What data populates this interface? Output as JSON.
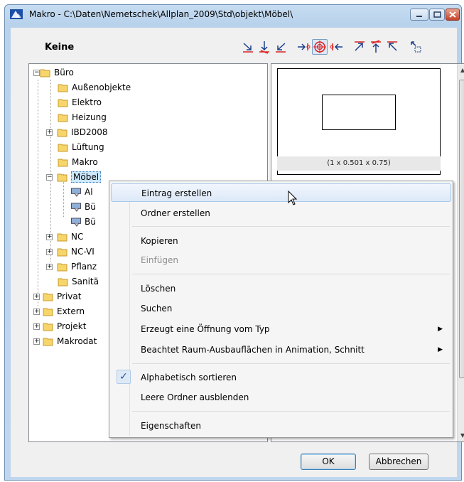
{
  "window": {
    "title": "Makro - C:\\Daten\\Nemetschek\\Allplan_2009\\Std\\objekt\\Möbel\\"
  },
  "header": {
    "label": "Keine"
  },
  "tree": {
    "root": "Büro",
    "children": [
      "Außenobjekte",
      "Elektro",
      "Heizung",
      "IBD2008",
      "Lüftung",
      "Makro",
      "Möbel"
    ],
    "moebel_items": [
      "Al",
      "Bü",
      "Bü"
    ],
    "after": [
      "NC",
      "NC-VI",
      "Pflanz",
      "Sanitä"
    ],
    "top_level": [
      "Privat",
      "Extern",
      "Projekt",
      "Makrodat"
    ]
  },
  "preview": {
    "caption": "(1 x 0.501 x 0.75)"
  },
  "context_menu": {
    "items": [
      {
        "label": "Eintrag erstellen"
      },
      {
        "label": "Ordner erstellen"
      },
      {
        "label": "Kopieren"
      },
      {
        "label": "Einfügen"
      },
      {
        "label": "Löschen"
      },
      {
        "label": "Suchen"
      },
      {
        "label": "Erzeugt eine Öffnung vom Typ"
      },
      {
        "label": "Beachtet Raum-Ausbauflächen in Animation, Schnitt"
      },
      {
        "label": "Alphabetisch sortieren"
      },
      {
        "label": "Leere Ordner ausblenden"
      },
      {
        "label": "Eigenschaften"
      }
    ],
    "check_glyph": "✓",
    "submenu_glyph": "▶"
  },
  "buttons": {
    "ok": "OK",
    "cancel": "Abbrechen"
  },
  "colors": {
    "selection": "#cce8ff",
    "accent": "#c4422a"
  }
}
